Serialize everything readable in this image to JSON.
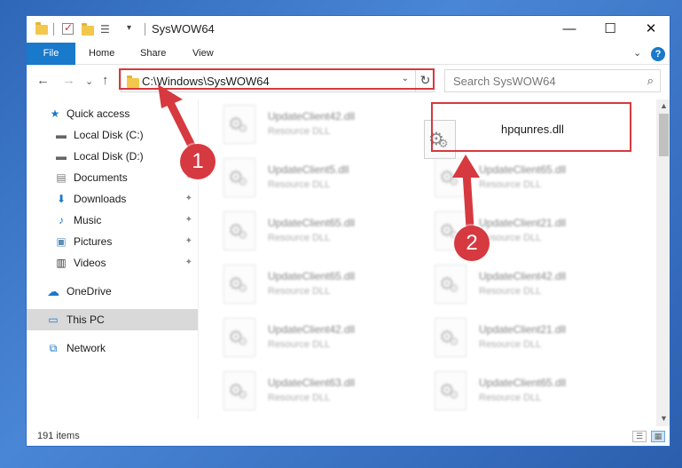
{
  "window": {
    "title": "SysWOW64",
    "minimize": "—",
    "maximize": "☐",
    "close": "✕"
  },
  "ribbon": {
    "tabs": [
      "File",
      "Home",
      "Share",
      "View"
    ],
    "expand": "⌄",
    "help": "?"
  },
  "navigation": {
    "back": "←",
    "forward": "→",
    "recent": "⌄",
    "up": "↑",
    "address": "C:\\Windows\\SysWOW64",
    "address_dropdown": "⌄",
    "refresh": "↻",
    "search_placeholder": "Search SysWOW64",
    "search_icon": "⌕"
  },
  "sidebar": {
    "items": [
      {
        "label": "Quick access",
        "icon": "★",
        "icon_name": "star-icon"
      },
      {
        "label": "Local Disk (C:)",
        "icon": "▬",
        "icon_name": "drive-icon",
        "pinned": true
      },
      {
        "label": "Local Disk (D:)",
        "icon": "▬",
        "icon_name": "drive-icon"
      },
      {
        "label": "Documents",
        "icon": "▤",
        "icon_name": "documents-icon",
        "pinned": true
      },
      {
        "label": "Downloads",
        "icon": "⬇",
        "icon_name": "downloads-icon",
        "pinned": true
      },
      {
        "label": "Music",
        "icon": "♪",
        "icon_name": "music-icon",
        "pinned": true
      },
      {
        "label": "Pictures",
        "icon": "▣",
        "icon_name": "pictures-icon",
        "pinned": true
      },
      {
        "label": "Videos",
        "icon": "▥",
        "icon_name": "videos-icon",
        "pinned": true
      },
      {
        "label": "OneDrive",
        "icon": "☁",
        "icon_name": "onedrive-icon"
      },
      {
        "label": "This PC",
        "icon": "▭",
        "icon_name": "computer-icon",
        "selected": true
      },
      {
        "label": "Network",
        "icon": "⧉",
        "icon_name": "network-icon"
      }
    ],
    "pin_glyph": "📌"
  },
  "files": {
    "selected": {
      "name": "hpqunres.dll",
      "type": ""
    },
    "left_column": [
      {
        "name": "UpdateClient42.dll",
        "type": "Resource DLL"
      },
      {
        "name": "UpdateClient5.dll",
        "type": "Resource DLL"
      },
      {
        "name": "UpdateClient65.dll",
        "type": "Resource DLL"
      },
      {
        "name": "UpdateClient65.dll",
        "type": "Resource DLL"
      },
      {
        "name": "UpdateClient42.dll",
        "type": "Resource DLL"
      },
      {
        "name": "UpdateClient63.dll",
        "type": "Resource DLL"
      }
    ],
    "right_column": [
      {
        "name": "UpdateClient65.dll",
        "type": "Resource DLL"
      },
      {
        "name": "UpdateClient21.dll",
        "type": "Resource DLL"
      },
      {
        "name": "UpdateClient42.dll",
        "type": "Resource DLL"
      },
      {
        "name": "UpdateClient21.dll",
        "type": "Resource DLL"
      },
      {
        "name": "UpdateClient65.dll",
        "type": "Resource DLL"
      }
    ]
  },
  "statusbar": {
    "item_count": "191 items"
  },
  "annotations": {
    "step1": "1",
    "step2": "2",
    "color": "#d6393f"
  }
}
